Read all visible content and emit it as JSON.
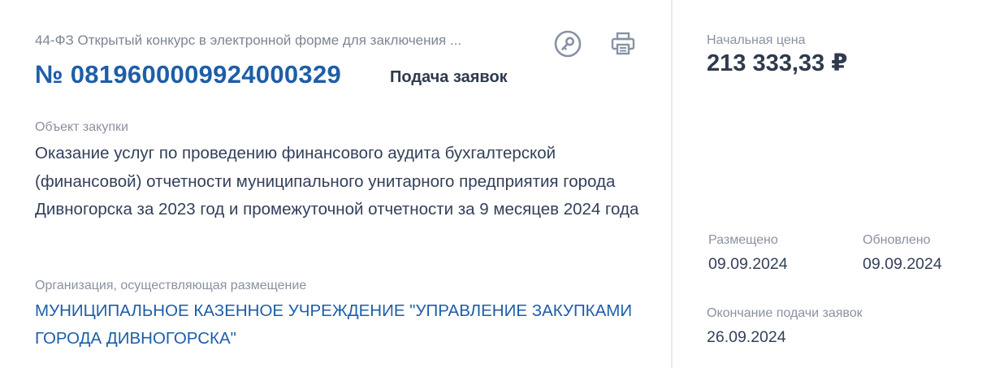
{
  "purchase": {
    "procedure_type": "44-ФЗ  Открытый конкурс в электронной форме для заключения ...",
    "number": "№ 0819600009924000329",
    "stage": "Подача заявок",
    "object_label": "Объект закупки",
    "object_text": "Оказание услуг по проведению финансового аудита бухгалтерской (финансовой) отчетности муниципального унитарного предприятия города Дивногорска за 2023 год и промежуточной отчетности за 9 месяцев 2024 года",
    "org_label": "Организация, осуществляющая размещение",
    "org_name": "МУНИЦИПАЛЬНОЕ КАЗЕННОЕ УЧРЕЖДЕНИЕ \"УПРАВЛЕНИЕ ЗАКУПКАМИ ГОРОДА ДИВНОГОРСКА\""
  },
  "icons": {
    "key": "key-icon",
    "print": "print-icon"
  },
  "price": {
    "label": "Начальная цена",
    "value": "213 333,33 ₽"
  },
  "dates": {
    "posted_label": "Размещено",
    "posted_value": "09.09.2024",
    "updated_label": "Обновлено",
    "updated_value": "09.09.2024",
    "deadline_label": "Окончание подачи заявок",
    "deadline_value": "26.09.2024"
  },
  "colors": {
    "link": "#1d5ea8",
    "text": "#334059",
    "muted": "#8a91a0",
    "icon": "#8892a6"
  }
}
